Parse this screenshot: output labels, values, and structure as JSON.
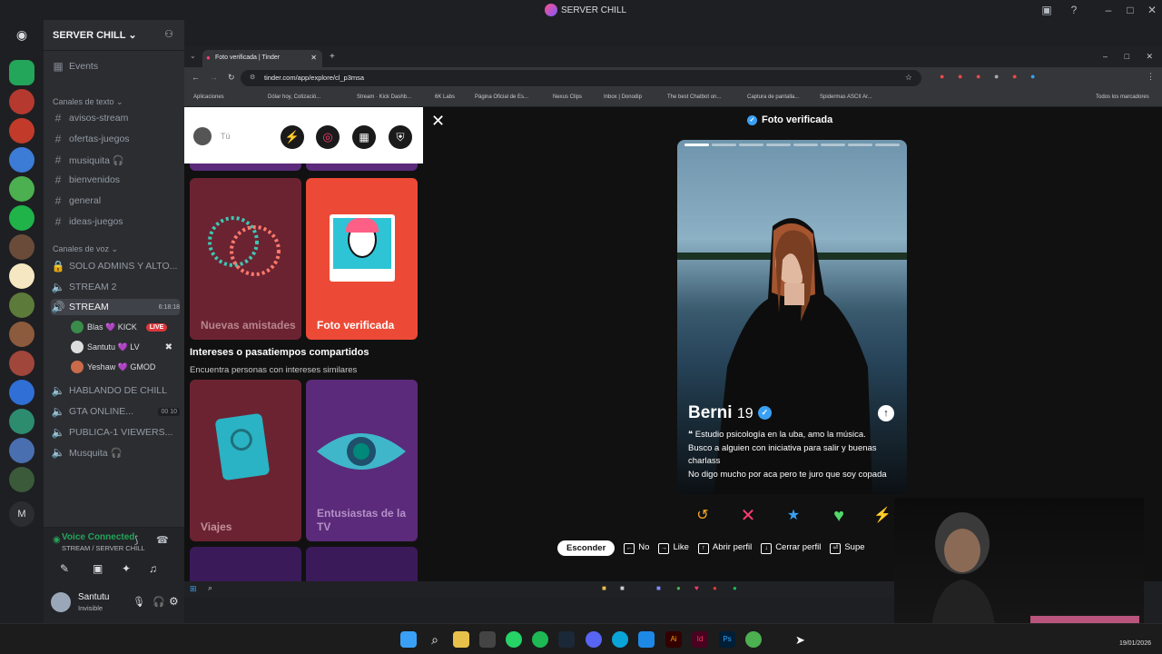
{
  "window": {
    "title": "SERVER CHILL"
  },
  "server": {
    "name": "SERVER CHILL",
    "events_label": "Events",
    "text_category": "Canales de texto",
    "voice_category": "Canales de voz",
    "text_channels": [
      "avisos-stream",
      "ofertas-juegos",
      "musiquita 🎧",
      "bienvenidos",
      "general",
      "ideas-juegos"
    ],
    "voice_channels": [
      {
        "name": "SOLO ADMINS Y ALTO..."
      },
      {
        "name": "STREAM 2"
      },
      {
        "name": "STREAM",
        "time": "6:18:18"
      }
    ],
    "voice_users": [
      {
        "name": "Blas 💜 KICK",
        "badge": "LIVE"
      },
      {
        "name": "Santutu 💜 LV"
      },
      {
        "name": "Yeshaw 💜 GMOD"
      }
    ],
    "more_voice_channels": [
      {
        "name": "HABLANDO DE CHILL"
      },
      {
        "name": "GTA ONLINE...",
        "count_a": "00",
        "count_b": "10"
      },
      {
        "name": "PUBLICA-1 VIEWERS..."
      },
      {
        "name": "Musquita 🎧"
      }
    ],
    "voice_connected": {
      "title": "Voice Connected",
      "subtitle": "STREAM / SERVER CHILL"
    },
    "user": {
      "name": "Santutu",
      "status": "Invisible"
    }
  },
  "browser": {
    "tab_title": "Foto verificada | Tinder",
    "url": "tinder.com/app/explore/cl_p3msa",
    "bookmarks": [
      "Aplicaciones",
      "Dólar hoy, Cotizació...",
      "Stream · Kick Dashb...",
      "6K Labs",
      "Página Oficial de Es...",
      "Nexus Clips",
      "Inbox | Donodip",
      "The best Chatbot on...",
      "Captura de pantalla...",
      "Spidermas ASCII Ar...",
      "Todos los marcadores"
    ]
  },
  "tinder": {
    "me_label": "Tú",
    "cards": [
      {
        "label": "Nuevas amistades",
        "color": "#6b2332"
      },
      {
        "label": "Foto verificada",
        "color": "#ec4a36"
      },
      {
        "label": "Viajes",
        "color": "#6b2332"
      },
      {
        "label": "Entusiastas de la TV",
        "color": "#5b2a7a"
      }
    ],
    "section_title": "Intereses o pasatiempos compartidos",
    "section_sub": "Encuentra personas con intereses similares",
    "header": "Foto verificada",
    "profile": {
      "name": "Berni",
      "age": "19",
      "bio_lines": [
        "❝ Estudio psicología en la uba, amo la música.",
        "Busco a alguien con iniciativa para salir y buenas charlass",
        "No digo mucho por aca pero te juro que soy copada"
      ]
    },
    "shortcuts": [
      "Esconder",
      "No",
      "Like",
      "Abrir perfil",
      "Cerrar perfil",
      "Supe"
    ]
  },
  "taskbar": {
    "time": "19/01/2026"
  }
}
